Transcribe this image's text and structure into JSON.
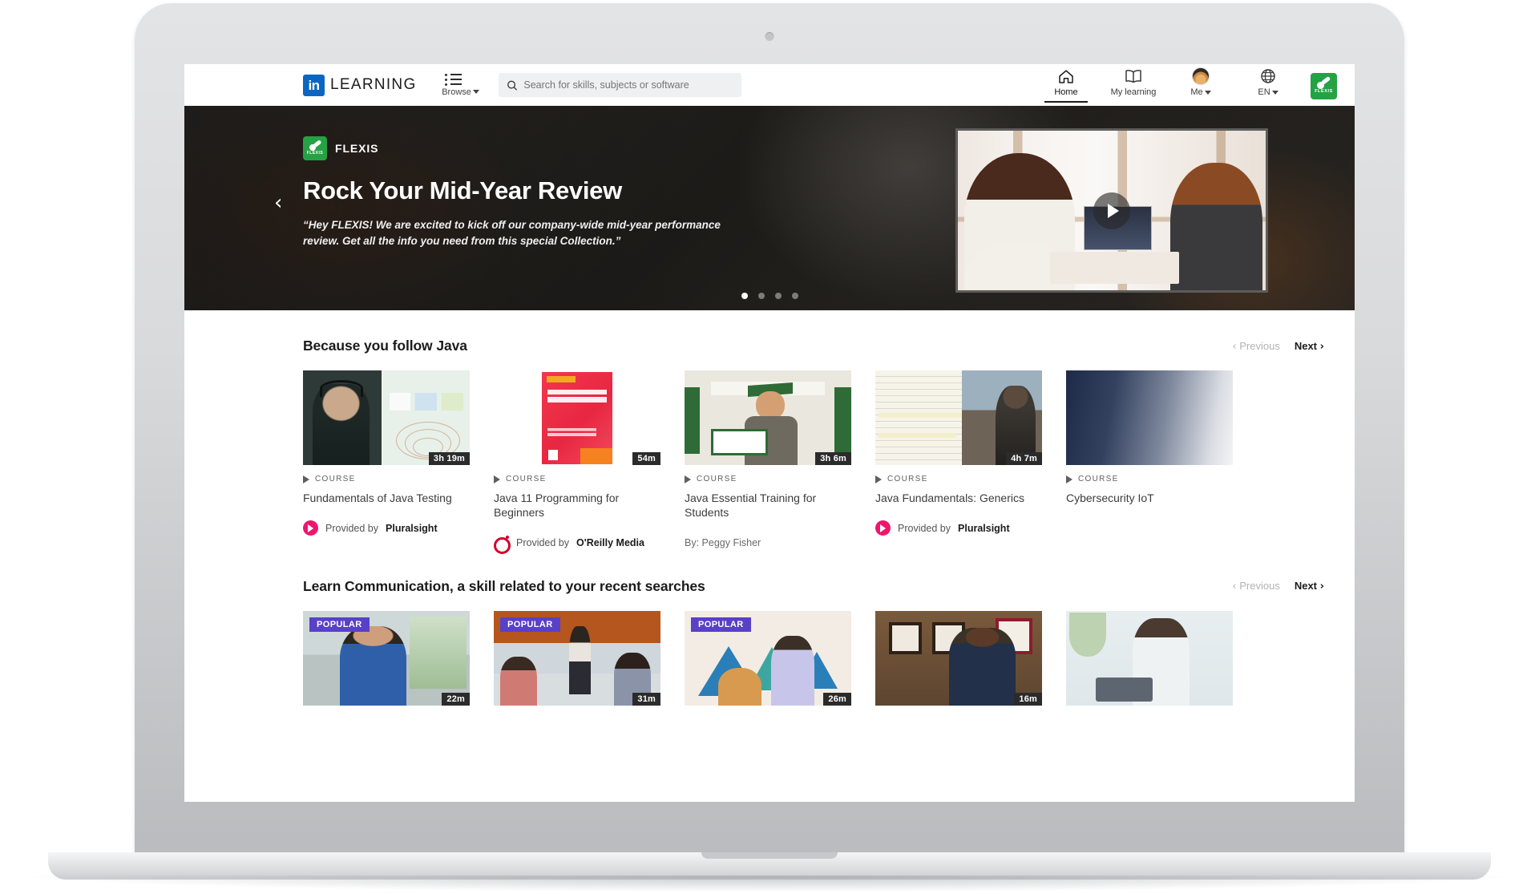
{
  "nav": {
    "logo_mark": "in",
    "logo_word": "LEARNING",
    "browse_label": "Browse",
    "browse_icon": "list-icon",
    "search": {
      "placeholder": "Search for skills, subjects or software",
      "value": "",
      "icon": "search-icon"
    },
    "items": [
      {
        "label": "Home",
        "icon": "home-icon",
        "active": true
      },
      {
        "label": "My learning",
        "icon": "book-icon",
        "active": false
      },
      {
        "label": "Me",
        "icon": "avatar-icon",
        "active": false,
        "caret": true
      },
      {
        "label": "EN",
        "icon": "globe-icon",
        "active": false,
        "caret": true
      }
    ],
    "org_badge": {
      "name": "FLEXIS",
      "color": "#25a244"
    }
  },
  "hero": {
    "brand_badge": "FLEXIS",
    "brand_name": "FLEXIS",
    "title": "Rock Your Mid-Year Review",
    "subtitle": "“Hey FLEXIS! We are excited to kick off our company-wide mid-year performance review. Get all the info you need from this special Collection.”",
    "prev_icon": "chevron-left-icon",
    "next_icon": "chevron-right-icon",
    "play_icon": "play-icon",
    "slide_count": 4,
    "active_slide": 1
  },
  "sections": [
    {
      "title": "Because you follow Java",
      "prev_label": "Previous",
      "next_label": "Next",
      "cards": [
        {
          "type_label": "COURSE",
          "title": "Fundamentals of Java Testing",
          "duration": "3h 19m",
          "provider_prefix": "Provided by",
          "provider": "Pluralsight",
          "provider_logo": "pluralsight-logo",
          "thumb_class": "t1",
          "badge": ""
        },
        {
          "type_label": "COURSE",
          "title": "Java 11 Programming for Beginners",
          "duration": "54m",
          "provider_prefix": "Provided by",
          "provider": "O'Reilly Media",
          "provider_logo": "oreilly-logo",
          "thumb_class": "t2",
          "badge": ""
        },
        {
          "type_label": "COURSE",
          "title": "Java Essential Training for Students",
          "duration": "3h 6m",
          "author_line": "By: Peggy Fisher",
          "thumb_class": "t3",
          "badge": ""
        },
        {
          "type_label": "COURSE",
          "title": "Java Fundamentals: Generics",
          "duration": "4h 7m",
          "provider_prefix": "Provided by",
          "provider": "Pluralsight",
          "provider_logo": "pluralsight-logo",
          "thumb_class": "t4",
          "badge": ""
        },
        {
          "type_label": "COURSE",
          "title": "Cybersecurity IoT",
          "duration": "",
          "thumb_class": "t5",
          "badge": ""
        }
      ]
    },
    {
      "title": "Learn Communication, a skill related to your recent searches",
      "prev_label": "Previous",
      "next_label": "Next",
      "cards": [
        {
          "badge": "POPULAR",
          "duration": "22m",
          "thumb_class": "c1"
        },
        {
          "badge": "POPULAR",
          "duration": "31m",
          "thumb_class": "c2"
        },
        {
          "badge": "POPULAR",
          "duration": "26m",
          "thumb_class": "c3"
        },
        {
          "badge": "",
          "duration": "16m",
          "thumb_class": "c4"
        },
        {
          "badge": "",
          "duration": "",
          "thumb_class": "c5"
        }
      ]
    }
  ],
  "colors": {
    "linkedin_blue": "#0a66c2",
    "flexis_green": "#25a244",
    "popular_purple": "#5940c9",
    "pluralsight_pink": "#f0156e",
    "oreilly_red": "#d3002d"
  }
}
